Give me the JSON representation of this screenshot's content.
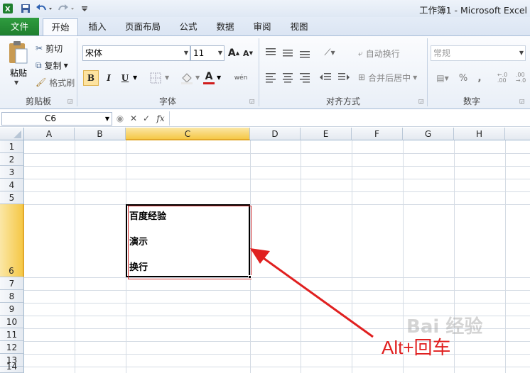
{
  "window": {
    "title": "工作簿1 - Microsoft Excel"
  },
  "quick_access": {
    "save_icon": "save-icon",
    "undo_icon": "undo-icon",
    "redo_icon": "redo-icon",
    "customize_icon": "customize-icon"
  },
  "tabs": [
    {
      "label": "文件"
    },
    {
      "label": "开始"
    },
    {
      "label": "插入"
    },
    {
      "label": "页面布局"
    },
    {
      "label": "公式"
    },
    {
      "label": "数据"
    },
    {
      "label": "审阅"
    },
    {
      "label": "视图"
    }
  ],
  "clipboard": {
    "paste": "粘贴",
    "cut": "剪切",
    "copy": "复制",
    "format_painter": "格式刷",
    "group": "剪贴板"
  },
  "font": {
    "name": "宋体",
    "size": "11",
    "bold": "B",
    "italic": "I",
    "underline": "U",
    "color_letter": "A",
    "group": "字体",
    "grow": "A",
    "shrink": "A",
    "phonetic": "wén"
  },
  "alignment": {
    "wrap_text": "自动换行",
    "merge_center": "合并后居中",
    "group": "对齐方式"
  },
  "number": {
    "format": "常规",
    "percent": "%",
    "comma": ",",
    "group": "数字",
    "inc_decimal": "←.0\n.00",
    "dec_decimal": ".00\n→.0"
  },
  "formula_bar": {
    "name_box": "C6",
    "cancel": "✕",
    "enter": "✓",
    "fx": "fx",
    "value": ""
  },
  "sheet": {
    "columns": [
      "A",
      "B",
      "C",
      "D",
      "E",
      "F",
      "G",
      "H"
    ],
    "rows": [
      "1",
      "2",
      "3",
      "4",
      "5",
      "6",
      "7",
      "8",
      "9",
      "10",
      "11",
      "12",
      "13",
      "14"
    ],
    "active_cell": "C6",
    "cell_lines": [
      "百度经验",
      "演示",
      "换行"
    ]
  },
  "annotation": {
    "text": "Alt+回车",
    "color": "#e02020"
  },
  "watermark": {
    "text": "Bai 经验"
  },
  "colors": {
    "accent_file_tab": "#2a8f38",
    "selection_header": "#ffd966",
    "arrow": "#e02020"
  }
}
